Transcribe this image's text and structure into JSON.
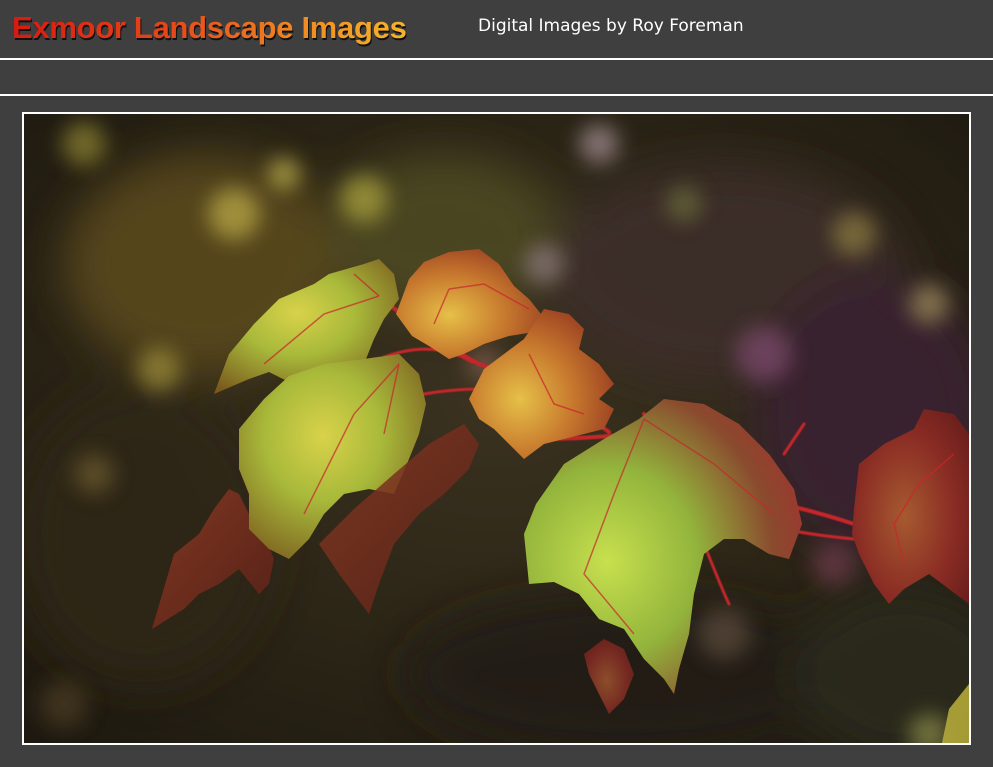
{
  "header": {
    "title": "Exmoor Landscape Images",
    "subtitle": "Digital Images by Roy Foreman"
  },
  "photo": {
    "subject": "autumn-maple-leaves-photo",
    "colors": {
      "background_dark": "#2a2418",
      "leaf_green": "#9bb83a",
      "leaf_red": "#a83a28",
      "stem_red": "#c8262a"
    }
  },
  "colors": {
    "page_bg": "#3f3f3f",
    "divider": "#ffffff",
    "title_start": "#d81a10",
    "title_end": "#f6b52a",
    "subtitle": "#ffffff"
  }
}
